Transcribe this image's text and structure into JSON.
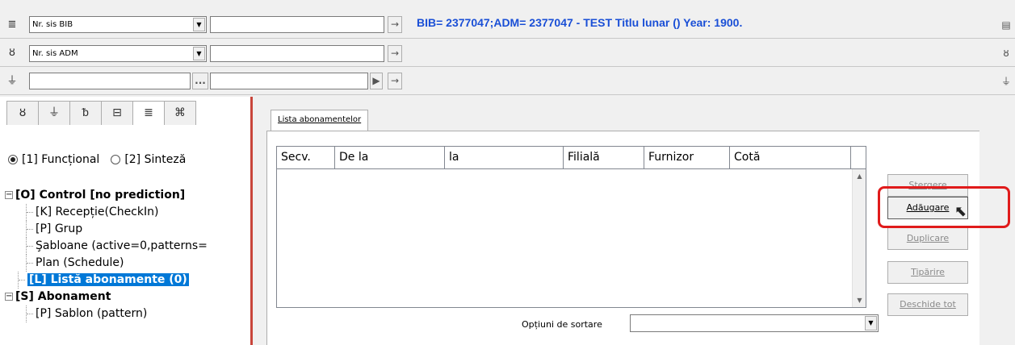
{
  "toolbar_rows": [
    {
      "icon": "list-icon",
      "icon_glyph": "≣",
      "combo_value": "Nr. sis BIB"
    },
    {
      "icon": "tag-icon",
      "icon_glyph": "ȣ",
      "combo_value": "Nr. sis ADM"
    },
    {
      "icon": "filter-icon",
      "icon_glyph": "⏚",
      "combo_value": ""
    }
  ],
  "info_line": "BIB= 2377047;ADM= 2377047 - TEST Titlu lunar () Year: 1900.",
  "browse_button_label": "...",
  "left_tabs": [
    "ȣ",
    "⏚",
    "ᵬ",
    "⊟",
    "≣",
    "⌘"
  ],
  "radio": {
    "option1": "[1] Funcțional",
    "option2": "[2] Sinteză"
  },
  "tree": {
    "root": "[O] Control [no prediction]",
    "children": [
      "[K] Recepție(CheckIn)",
      "[P] Grup",
      "Şabloane (active=0,patterns=",
      "Plan (Schedule)"
    ],
    "selected": "[L] Listă abonamente (0)",
    "next": "[S] Abonament",
    "next_child": "[P] Sablon (pattern)"
  },
  "main_tab": "Lista abonamentelor",
  "grid_columns": [
    "Secv.",
    "De la",
    "la",
    "Filială",
    "Furnizor",
    "Cotă"
  ],
  "buttons": {
    "delete": "Stergere",
    "add": "Adăugare",
    "duplicate": "Duplicare",
    "print": "Tipărire",
    "open_all": "Deschide tot"
  },
  "sort": {
    "label": "Opțiuni de sortare",
    "value": ""
  }
}
